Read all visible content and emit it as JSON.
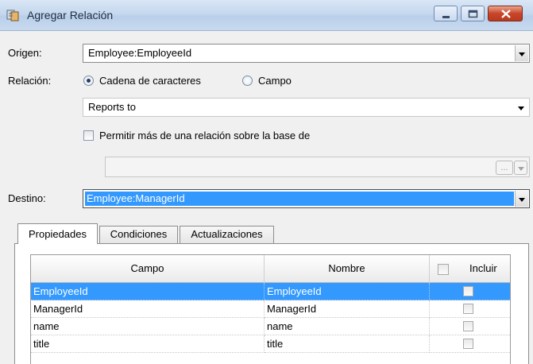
{
  "window": {
    "title": "Agregar Relación",
    "controls": [
      "minimize",
      "maximize",
      "close"
    ]
  },
  "form": {
    "origen": {
      "label": "Origen:",
      "value": "Employee:EmployeeId"
    },
    "relacion": {
      "label": "Relación:",
      "options": [
        {
          "label": "Cadena de caracteres",
          "selected": true
        },
        {
          "label": "Campo",
          "selected": false
        }
      ],
      "value": "Reports to"
    },
    "permitir": {
      "label": "Permitir más de una relación sobre la base de",
      "checked": false
    },
    "base_de": {
      "value": "",
      "ellipsis_label": "...",
      "enabled": false
    },
    "destino": {
      "label": "Destino:",
      "value": "Employee:ManagerId"
    }
  },
  "tabs": [
    {
      "label": "Propiedades",
      "active": true
    },
    {
      "label": "Condiciones",
      "active": false
    },
    {
      "label": "Actualizaciones",
      "active": false
    }
  ],
  "grid": {
    "columns": [
      "Campo",
      "Nombre",
      "Incluir"
    ],
    "header_checkbox_checked": false,
    "rows": [
      {
        "campo": "EmployeeId",
        "nombre": "EmployeeId",
        "incluir": false,
        "selected": true
      },
      {
        "campo": "ManagerId",
        "nombre": "ManagerId",
        "incluir": false,
        "selected": false
      },
      {
        "campo": "name",
        "nombre": "name",
        "incluir": false,
        "selected": false
      },
      {
        "campo": "title",
        "nombre": "title",
        "incluir": false,
        "selected": false
      }
    ]
  },
  "colors": {
    "selection": "#3399ff",
    "titlebar": "#c5d8ee",
    "close_button": "#c9452a"
  }
}
